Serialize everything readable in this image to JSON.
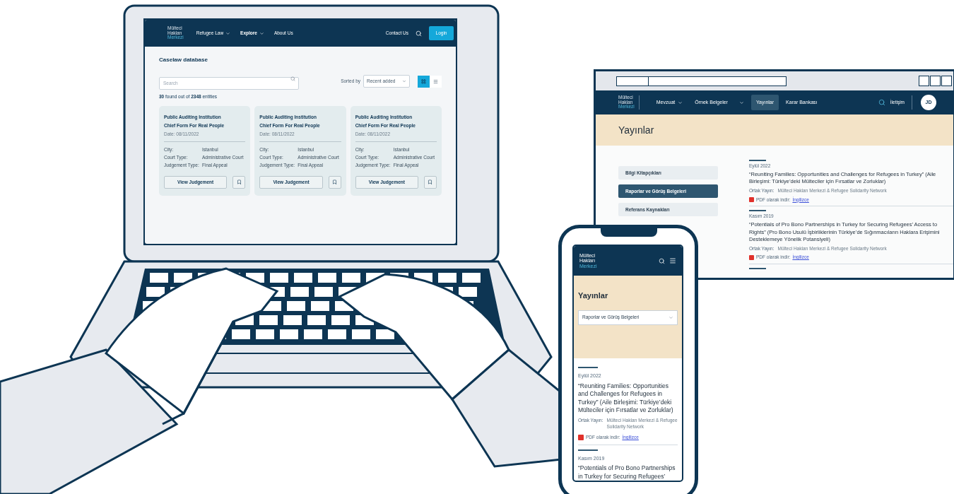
{
  "laptop": {
    "logo": [
      "Mülteci",
      "Hakları",
      "Merkezi"
    ],
    "nav": [
      {
        "label": "Refugee Law",
        "dropdown": true,
        "selected": false
      },
      {
        "label": "Explore",
        "dropdown": true,
        "selected": true
      },
      {
        "label": "About Us",
        "dropdown": false,
        "selected": false
      }
    ],
    "contact": "Contact Us",
    "login": "Login",
    "title": "Caselaw database",
    "search": {
      "placeholder": "Search"
    },
    "sort_label": "Sorted by",
    "sort_value": "Recent added",
    "views": [
      {
        "kind": "grid",
        "selected": true
      },
      {
        "kind": "list",
        "selected": false
      }
    ],
    "count": "**30** found out of **2348** entities",
    "cards": [
      {
        "title": [
          "Public Auditing Institution",
          "Chief Form For Real People"
        ],
        "date": "Date: 08/11/2022",
        "fields": [
          [
            "City:",
            "Istanbul"
          ],
          [
            "Court Type:",
            "Administrative Court"
          ],
          [
            "Judgement Type:",
            "Final Appeal"
          ]
        ],
        "button": "View Judgement"
      },
      {
        "title": [
          "Public Auditing Institution",
          "Chief Form For Real People"
        ],
        "date": "Date: 08/11/2022",
        "fields": [
          [
            "City:",
            "Istanbul"
          ],
          [
            "Court Type:",
            "Administrative Court"
          ],
          [
            "Judgement Type:",
            "Final Appeal"
          ]
        ],
        "button": "View Judgement"
      },
      {
        "title": [
          "Public Auditing Institution",
          "Chief Form For Real People"
        ],
        "date": "Date: 08/11/2022",
        "fields": [
          [
            "City:",
            "Istanbul"
          ],
          [
            "Court Type:",
            "Administrative Court"
          ],
          [
            "Judgement Type:",
            "Final Appeal"
          ]
        ],
        "button": "View Judgement"
      }
    ]
  },
  "browser": {
    "logo": [
      "Mülteci",
      "Hakları",
      "Merkezi"
    ],
    "nav": [
      {
        "label": "Mevzuat",
        "dropdown": true,
        "selected": false
      },
      {
        "label": "Örnek Belgeler",
        "dropdown": true,
        "selected": false
      },
      {
        "label": "Yayınlar",
        "dropdown": false,
        "selected": true
      },
      {
        "label": "Karar Bankası",
        "dropdown": false,
        "selected": false
      }
    ],
    "contact": "İletişim",
    "avatar": "JD",
    "heading": "Yayınlar",
    "sidebar": [
      {
        "label": "Bilgi Kitapçıkları",
        "selected": false
      },
      {
        "label": "Raporlar ve Görüş Belgeleri",
        "selected": true
      },
      {
        "label": "Referans Kaynakları",
        "selected": false
      }
    ],
    "publications": [
      {
        "date": "Eylül 2022",
        "title": "“Reuniting Families: Opportunities and Challenges for Refugees in Turkey” (Aile Birleşimi: Türkiye’deki Mülteciler için Fırsatlar ve Zorluklar)",
        "co_label": "Ortak Yayın:",
        "co_value": "Mülteci Hakları Merkezi & Refugee Solidarity Network",
        "pdf_label": "PDF olarak indir:",
        "link": "İngilizce"
      },
      {
        "date": "Kasım 2019",
        "title": "“Potentials of Pro Bono Partnerships in Turkey for Securing Refugees’ Access to Rights” (Pro Bono Usulü İşbirliklerinin Türkiye’de Sığınmacıların Haklara Erişimini Desteklemeye Yönelik Potansiyeli)",
        "co_label": "Ortak Yayın:",
        "co_value": "Mülteci Hakları Merkezi & Refugee Solidarity Network",
        "pdf_label": "PDF olarak indir:",
        "link": "İngilizce"
      }
    ]
  },
  "phone": {
    "logo": [
      "Mülteci",
      "Hakları",
      "Merkezi"
    ],
    "heading": "Yayınlar",
    "select": "Raporlar ve Görüş Belgeleri",
    "publications": [
      {
        "date": "Eylül 2022",
        "title": "“Reuniting Families: Opportunities and Challenges for Refugees in Turkey” (Aile Birleşimi: Türkiye’deki Mülteciler için Fırsatlar ve Zorluklar)",
        "co_label": "Ortak Yayın:",
        "co_value": "Mülteci Hakları Merkezi & Refugee Solidarity Network",
        "pdf_label": "PDF olarak indir:",
        "link": "İngilizce"
      },
      {
        "date": "Kasım 2019",
        "title": "“Potentials of Pro Bono Partnerships in Turkey for Securing Refugees’"
      }
    ]
  }
}
